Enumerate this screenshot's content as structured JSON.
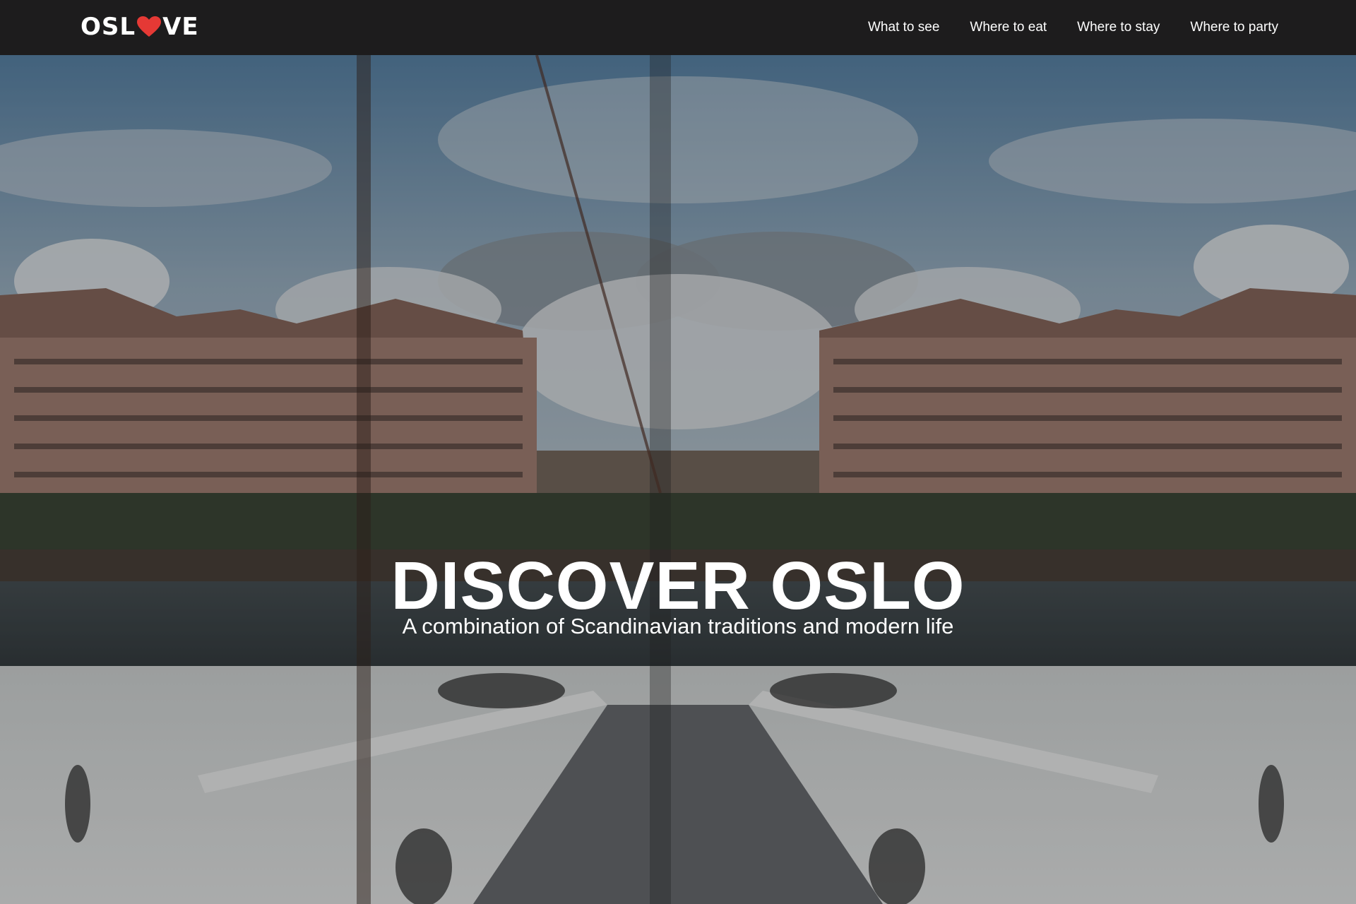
{
  "brand": {
    "logo_prefix": "OSL",
    "logo_suffix": "VE",
    "heart_icon": "heart-icon",
    "heart_color": "#e53935"
  },
  "nav": {
    "items": [
      {
        "label": "What to see"
      },
      {
        "label": "Where to eat"
      },
      {
        "label": "Where to stay"
      },
      {
        "label": "Where to party"
      }
    ]
  },
  "hero": {
    "title": "DISCOVER OSLO",
    "subtitle": "A combination of Scandinavian traditions and modern life"
  },
  "colors": {
    "navbar_bg": "#1d1c1d",
    "text": "#ffffff"
  }
}
